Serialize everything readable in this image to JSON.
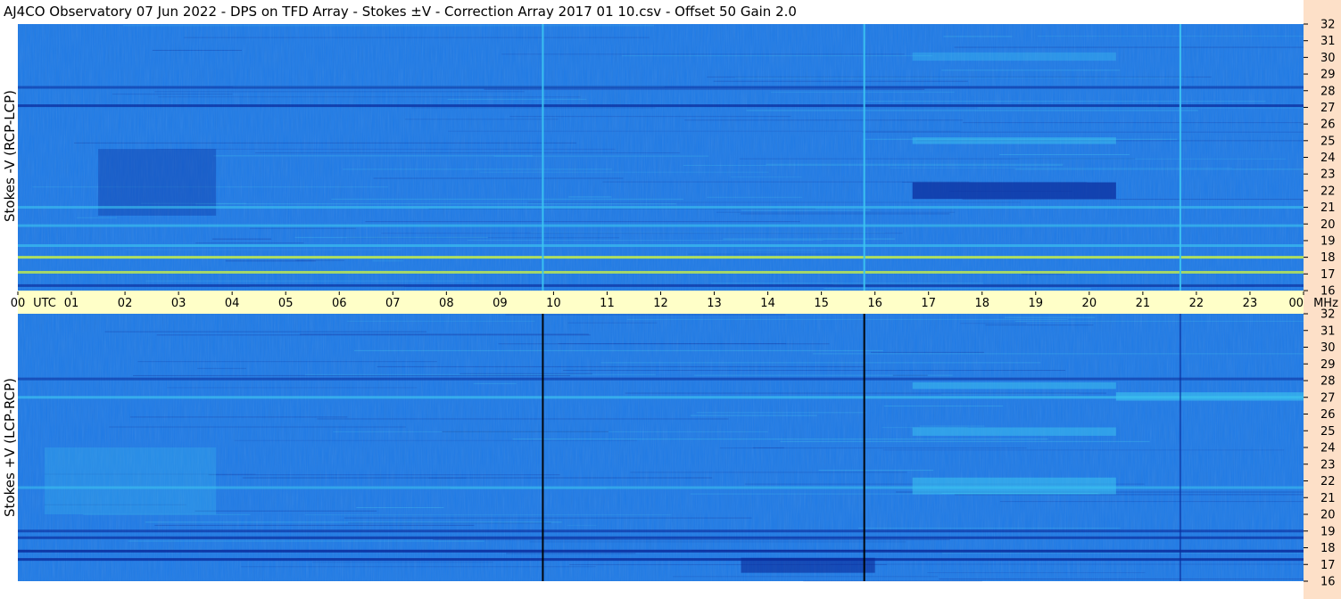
{
  "title": "AJ4CO Observatory  07 Jun 2022  -  DPS on TFD Array  -  Stokes ±V  -  Correction Array 2017 01 10.csv  -  Offset 50  Gain 2.0",
  "colors": {
    "background": "#ffffff",
    "time_band": "#ffffc8",
    "freq_strip": "#fde0c8",
    "spectrogram_base": "#1e7ae6",
    "spectrogram_dark": "#0a2a9a",
    "spectrogram_light": "#3cc4f0",
    "spectrogram_hot": "#c8f046"
  },
  "chart_data": [
    {
      "type": "heatmap",
      "panel": "top",
      "ylabel": "Stokes -V (RCP-LCP)",
      "xlim": [
        0,
        24
      ],
      "ylim": [
        16,
        32
      ],
      "y_ticks": [
        "16",
        "17",
        "18",
        "19",
        "20",
        "21",
        "22",
        "23",
        "24",
        "25",
        "26",
        "27",
        "28",
        "29",
        "30",
        "31",
        "32"
      ],
      "y_unit": "MHz",
      "vertical_lines": [
        {
          "hour": 9.8,
          "style": "light"
        },
        {
          "hour": 15.8,
          "style": "light"
        },
        {
          "hour": 21.7,
          "style": "light"
        }
      ],
      "horizontal_bands": [
        {
          "mhz": 27.1,
          "intensity": -0.7
        },
        {
          "mhz": 28.2,
          "intensity": -0.4
        },
        {
          "mhz": 21.0,
          "intensity": 0.5
        },
        {
          "mhz": 19.9,
          "intensity": 0.5
        },
        {
          "mhz": 18.7,
          "intensity": 0.6
        },
        {
          "mhz": 18.0,
          "intensity": 0.9
        },
        {
          "mhz": 17.1,
          "intensity": 0.8
        },
        {
          "mhz": 16.3,
          "intensity": -0.6
        }
      ],
      "regions": [
        {
          "h0": 16.7,
          "h1": 20.5,
          "f0": 21.5,
          "f1": 22.5,
          "intensity": -0.7
        },
        {
          "h0": 16.7,
          "h1": 20.5,
          "f0": 24.8,
          "f1": 25.2,
          "intensity": 0.5
        },
        {
          "h0": 1.5,
          "h1": 3.7,
          "f0": 20.5,
          "f1": 24.5,
          "intensity": -0.35
        },
        {
          "h0": 16.7,
          "h1": 20.5,
          "f0": 29.8,
          "f1": 30.3,
          "intensity": 0.35
        }
      ]
    },
    {
      "type": "heatmap",
      "panel": "bottom",
      "ylabel": "Stokes +V (LCP-RCP)",
      "xlim": [
        0,
        24
      ],
      "ylim": [
        16,
        32
      ],
      "y_ticks": [
        "16",
        "17",
        "18",
        "19",
        "20",
        "21",
        "22",
        "23",
        "24",
        "25",
        "26",
        "27",
        "28",
        "29",
        "30",
        "31",
        "32"
      ],
      "y_unit": "MHz",
      "vertical_lines": [
        {
          "hour": 9.8,
          "style": "dark"
        },
        {
          "hour": 15.8,
          "style": "dark"
        },
        {
          "hour": 21.7,
          "style": "faint"
        }
      ],
      "horizontal_bands": [
        {
          "mhz": 27.0,
          "intensity": 0.6
        },
        {
          "mhz": 28.1,
          "intensity": -0.4
        },
        {
          "mhz": 21.6,
          "intensity": 0.4
        },
        {
          "mhz": 19.0,
          "intensity": -0.5
        },
        {
          "mhz": 18.6,
          "intensity": -0.6
        },
        {
          "mhz": 17.8,
          "intensity": -0.9
        },
        {
          "mhz": 17.3,
          "intensity": -0.8
        }
      ],
      "regions": [
        {
          "h0": 16.7,
          "h1": 20.5,
          "f0": 21.2,
          "f1": 22.2,
          "intensity": 0.55
        },
        {
          "h0": 16.7,
          "h1": 20.5,
          "f0": 24.7,
          "f1": 25.2,
          "intensity": 0.5
        },
        {
          "h0": 16.7,
          "h1": 20.5,
          "f0": 27.5,
          "f1": 27.9,
          "intensity": 0.5
        },
        {
          "h0": 0.5,
          "h1": 3.7,
          "f0": 20.0,
          "f1": 24.0,
          "intensity": 0.25
        },
        {
          "h0": 13.5,
          "h1": 16.0,
          "f0": 16.5,
          "f1": 17.4,
          "intensity": -0.6
        },
        {
          "h0": 20.5,
          "h1": 24.0,
          "f0": 26.8,
          "f1": 27.3,
          "intensity": 0.6
        }
      ]
    }
  ],
  "x_axis": {
    "tick_labels": [
      "00",
      "01",
      "02",
      "03",
      "04",
      "05",
      "06",
      "07",
      "08",
      "09",
      "10",
      "11",
      "12",
      "13",
      "14",
      "15",
      "16",
      "17",
      "18",
      "19",
      "20",
      "21",
      "22",
      "23",
      "00"
    ],
    "utc_label": "UTC",
    "unit_label": "MHz"
  }
}
